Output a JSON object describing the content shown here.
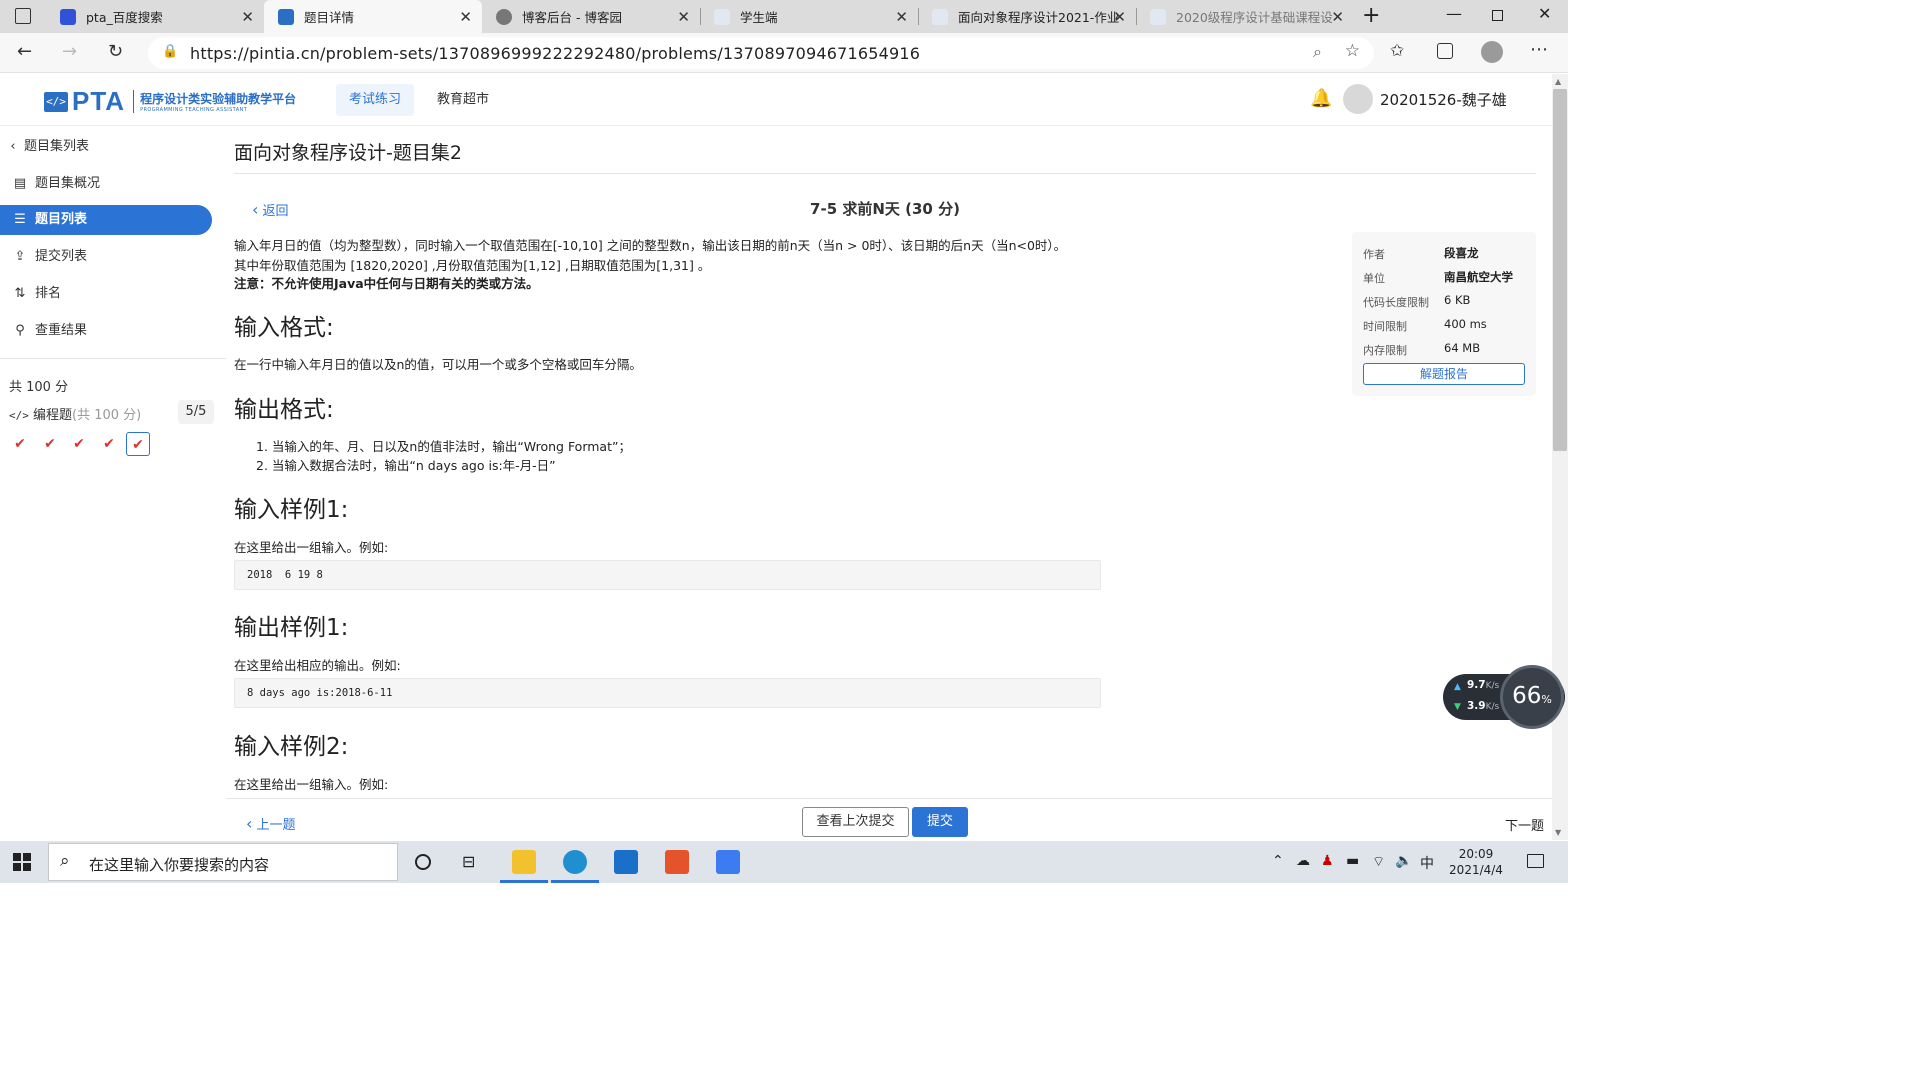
{
  "browser": {
    "tabs": [
      {
        "title": "pta_百度搜索",
        "favicon_color": "#3052d8"
      },
      {
        "title": "题目详情",
        "favicon_color": "#2b6fc4"
      },
      {
        "title": "博客后台 - 博客园",
        "favicon_color": "#777777"
      },
      {
        "title": "学生端",
        "favicon_color": "#e2e8f2"
      },
      {
        "title": "面向对象程序设计2021-作业",
        "favicon_color": "#e2e8f2"
      },
      {
        "title": "2020级程序设计基础课程设",
        "favicon_color": "#e2e8f2"
      }
    ],
    "url": "https://pintia.cn/problem-sets/1370896999222292480/problems/1370897094671654916"
  },
  "header": {
    "logo_text": "PTA",
    "logo_badge": "</>",
    "logo_subtitle": "程序设计类实验辅助教学平台",
    "logo_subtitle_en": "PROGRAMMING TEACHING ASSISTANT",
    "nav": [
      "考试练习",
      "教育超市"
    ],
    "username": "20201526-魏子雄"
  },
  "sidebar": {
    "back_label": "题目集列表",
    "items": [
      {
        "label": "题目集概况",
        "icon": "book-icon"
      },
      {
        "label": "题目列表",
        "icon": "list-icon"
      },
      {
        "label": "提交列表",
        "icon": "upload-icon"
      },
      {
        "label": "排名",
        "icon": "sort-icon"
      },
      {
        "label": "查重结果",
        "icon": "plagiarism-icon"
      }
    ],
    "total": "共 100 分",
    "section_label": "编程题",
    "section_points": "(共 100 分)",
    "section_progress": "5/5",
    "problem_count": 5
  },
  "problem_set_title": "面向对象程序设计-题目集2",
  "problem": {
    "back_label": "返回",
    "title": "7-5 求前N天 (30 分)",
    "desc_line1": "输入年月日的值（均为整型数），同时输入一个取值范围在[-10,10] 之间的整型数n，输出该日期的前n天（当n > 0时）、该日期的后n天（当n<0时）。",
    "desc_line2": "其中年份取值范围为 [1820,2020] ,月份取值范围为[1,12] ,日期取值范围为[1,31] 。",
    "note": "注意：不允许使用Java中任何与日期有关的类或方法。",
    "input_heading": "输入格式:",
    "input_text": "在一行中输入年月日的值以及n的值，可以用一个或多个空格或回车分隔。",
    "output_heading": "输出格式:",
    "output_items": [
      "1. 当输入的年、月、日以及n的值非法时，输出“Wrong Format”；",
      "2. 当输入数据合法时，输出“n days ago is:年-月-日”"
    ],
    "sample_in1_heading": "输入样例1:",
    "sample_in1_text": "在这里给出一组输入。例如:",
    "sample_in1_code": "2018  6 19 8",
    "sample_out1_heading": "输出样例1:",
    "sample_out1_text": "在这里给出相应的输出。例如:",
    "sample_out1_code": "8 days ago is:2018-6-11",
    "sample_in2_heading": "输入样例2:",
    "sample_in2_text": "在这里给出一组输入。例如:"
  },
  "info": [
    {
      "key": "作者",
      "value": "段喜龙"
    },
    {
      "key": "单位",
      "value": "南昌航空大学"
    },
    {
      "key": "代码长度限制",
      "value": "6 KB"
    },
    {
      "key": "时间限制",
      "value": "400 ms"
    },
    {
      "key": "内存限制",
      "value": "64 MB"
    }
  ],
  "report_button": "解题报告",
  "bottom": {
    "prev": "上一题",
    "last_submission": "查看上次提交",
    "submit": "提交",
    "next": "下一题"
  },
  "network_widget": {
    "up": "9.7",
    "down": "3.9",
    "unit": "K/s",
    "percent": "66",
    "percent_sign": "%"
  },
  "taskbar": {
    "search_placeholder": "在这里输入你要搜索的内容",
    "ime": "中",
    "time": "20:09",
    "date": "2021/4/4"
  },
  "colors": {
    "accent": "#2b73d4",
    "check": "#e03030"
  }
}
